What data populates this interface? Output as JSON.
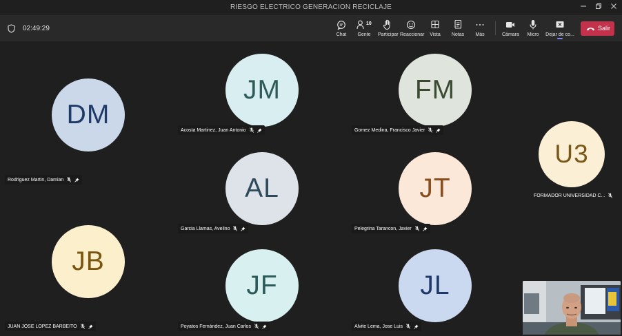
{
  "window": {
    "title": "RIESGO ELECTRICO GENERACION RECICLAJE",
    "minimize_icon": "minimize-icon",
    "restore_icon": "restore-icon",
    "close_icon": "close-icon"
  },
  "toolbar": {
    "timer": "02:49:29",
    "chat": "Chat",
    "people": "Gente",
    "people_count": "10",
    "raise": "Participar",
    "react": "Reaccionar",
    "view": "Vista",
    "notes": "Notas",
    "more": "Más",
    "camera": "Cámara",
    "mic": "Micro",
    "share": "Dejar de co...",
    "leave": "Salir"
  },
  "participants": [
    {
      "initials": "DM",
      "name": "Rodriguez Martin, Damian",
      "bg": "#cad8ea",
      "fg": "#1f3a66"
    },
    {
      "initials": "JM",
      "name": "Acosta Martinez, Juan Antonio",
      "bg": "#d9eef0",
      "fg": "#2e5a58"
    },
    {
      "initials": "FM",
      "name": "Gomez Medina, Francisco Javier",
      "bg": "#dfe4dc",
      "fg": "#3d4a33"
    },
    {
      "initials": "U3",
      "name": "FORMADOR UNIVERSIDAD C...",
      "bg": "#fbf0d6",
      "fg": "#7a5718"
    },
    {
      "initials": "AL",
      "name": "Garcia Llamas, Avelino",
      "bg": "#dde3e8",
      "fg": "#2e4a5a"
    },
    {
      "initials": "JT",
      "name": "Pelegrina Tarancon, Javier",
      "bg": "#fbe8d8",
      "fg": "#8a4d1e"
    },
    {
      "initials": "JB",
      "name": "JUAN JOSE LOPEZ BARBEITO",
      "bg": "#fcefcc",
      "fg": "#7a5510"
    },
    {
      "initials": "JF",
      "name": "Poyatos Fernández, Juan Carlos",
      "bg": "#d8f0ef",
      "fg": "#2b5a57"
    },
    {
      "initials": "JL",
      "name": "Alvite Lema, Jose Luis",
      "bg": "#cad9ef",
      "fg": "#1f3a6a"
    }
  ],
  "icons": {
    "mic_muted": "mic-muted-icon",
    "pin": "pin-icon"
  }
}
